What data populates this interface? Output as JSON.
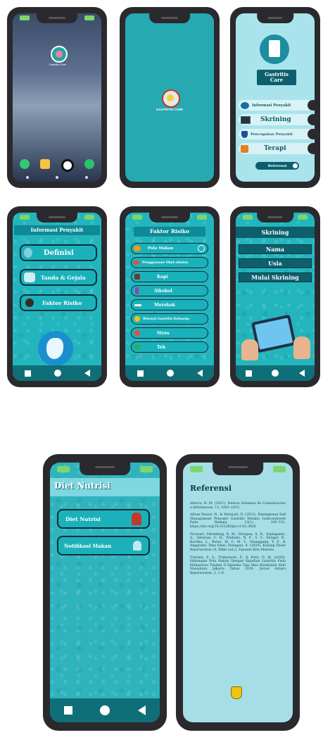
{
  "colors": {
    "teal": "#26a9b1",
    "dark": "#0d5f6d",
    "light": "#a9e4ec",
    "green": "#7bd66b"
  },
  "home": {
    "app_label": "Gastritis Care",
    "dock_icons": [
      "phone-icon",
      "folder-icon",
      "camera-icon",
      "browser-icon"
    ]
  },
  "splash": {
    "logo_text": "GASTRITIS CARE"
  },
  "main_menu": {
    "title": "Gastritis Care",
    "items": [
      {
        "label": "Informasi Penyakit",
        "icon": "book-icon"
      },
      {
        "label": "Skrining",
        "icon": "laptop-icon"
      },
      {
        "label": "Pencegahan Penyakit",
        "icon": "shield-icon"
      },
      {
        "label": "Terapi",
        "icon": "clipboard-icon"
      }
    ],
    "ref_label": "Referensi"
  },
  "info": {
    "title": "Informasi Penyakit",
    "items": [
      {
        "label": "Definisi",
        "icon": "bulb-icon"
      },
      {
        "label": "Tanda & Gejala",
        "icon": "people-icon"
      },
      {
        "label": "Faktor Risiko",
        "icon": "eye-icon"
      }
    ]
  },
  "faktor": {
    "title": "Faktor Risiko",
    "items": [
      "Pola Makan",
      "Penggunaan Obat-obatan",
      "Kopi",
      "Alkohol",
      "Merokok",
      "Riwayat Gastritis Keluarga",
      "Stres",
      "Teh"
    ]
  },
  "skrining": {
    "title": "Skrining",
    "fields": [
      "Nama",
      "Usia",
      "Mulai Skrining"
    ]
  },
  "diet": {
    "title": "Diet Nutrisi",
    "items": [
      "Diet Nutrisi",
      "Notifikasi Makan"
    ]
  },
  "referensi": {
    "title": "Referensi",
    "entries": [
      "Aburca, R. M. (2021). Neevos Sistemas de Comunicacion e Informacion, 13, 1003–1015.",
      "Afrian Nasari, N., & Widayati, D. (2023). Peningkatan Self Management Penyakit Gastritis Melalui Gastroedoweb Pada Remaja. 13(1), 145–152. https://doi.org/10.33126/ijhs.v13i1.3826",
      "Firawati, Sihombing, R. M., Hutapea, A. D., Supinganto, A., Siburian, C. H., Naibaho, N. F., S. V., Siregar, D., Kartika, L., Bolon, M. C. M. T., Sitanggang, Y. F., & Anggraini, Dina Dewi, Hulagaol, A. (2020). Konsep Dasar Keperawatan (A. Rikki (ed.)). Yayasan Kita Menulis.",
      "Futriani, E. S., Tridiyawati, F., & Putri, D. M. (2020). Hubungan Pola Makan Dengan Kejadian Gastritis Pada Mahasiswa Tingkat II Diploma Tiga Ilmu Kesehatan Abdi Nusantara Jakarta Tahun 2018. Jurnal Antara Keperawatan, 3, 1–6."
    ]
  }
}
